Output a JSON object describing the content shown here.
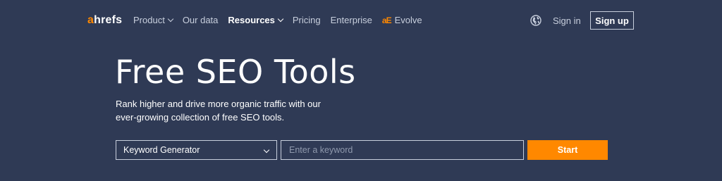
{
  "nav": {
    "logo_a": "a",
    "logo_rest": "hrefs",
    "links": [
      {
        "label": "Product",
        "has_dropdown": true
      },
      {
        "label": "Our data",
        "has_dropdown": false
      },
      {
        "label": "Resources",
        "has_dropdown": true
      },
      {
        "label": "Pricing",
        "has_dropdown": false
      },
      {
        "label": "Enterprise",
        "has_dropdown": false
      }
    ],
    "evolve_mark": "aE",
    "evolve_label": "Evolve",
    "signin_label": "Sign in",
    "signup_label": "Sign up"
  },
  "hero": {
    "title": "Free SEO Tools",
    "subtitle": "Rank higher and drive more organic traffic with our ever-growing collection of free SEO tools."
  },
  "form": {
    "tool_select_value": "Keyword Generator",
    "keyword_placeholder": "Enter a keyword",
    "start_label": "Start"
  },
  "colors": {
    "background": "#2f3a55",
    "accent": "#ff8800",
    "border": "#c8cfdd",
    "placeholder": "#8f99ad"
  },
  "icons": {
    "globe": "globe-icon",
    "dropdown": "chevron-down-icon"
  }
}
